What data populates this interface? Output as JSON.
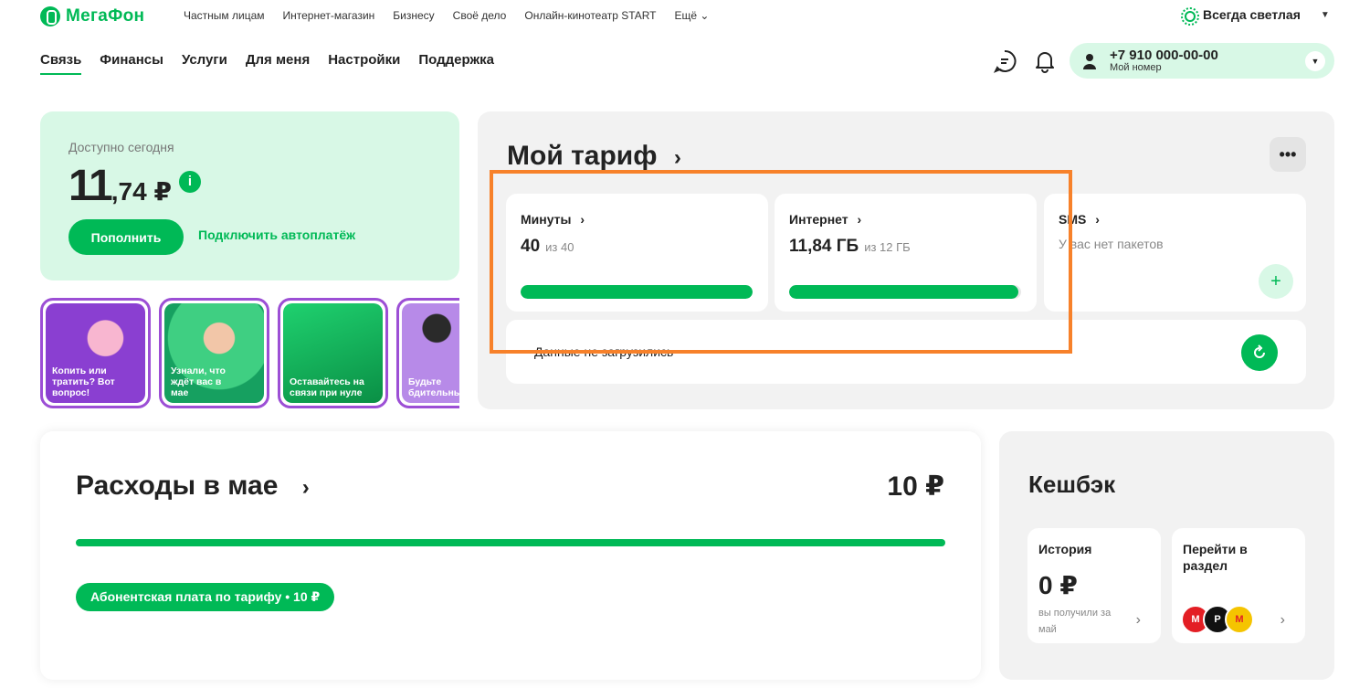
{
  "brand": {
    "name": "МегаФон"
  },
  "top_nav": [
    "Частным лицам",
    "Интернет-магазин",
    "Бизнесу",
    "Своё дело",
    "Онлайн-кинотеатр START",
    "Ещё"
  ],
  "theme": {
    "label": "Всегда светлая"
  },
  "main_nav": [
    "Связь",
    "Финансы",
    "Услуги",
    "Для меня",
    "Настройки",
    "Поддержка"
  ],
  "profile": {
    "phone": "+7 910 000-00-00",
    "caption": "Мой номер"
  },
  "balance": {
    "label": "Доступно сегодня",
    "whole": "11",
    "fraction": ",74 ₽",
    "topup_label": "Пополнить",
    "autopay_label": "Подключить автоплатёж"
  },
  "stories": [
    {
      "caption": "Копить или тратить? Вот вопрос!"
    },
    {
      "caption": "Узнали, что ждёт вас в мае"
    },
    {
      "caption": "Оставайтесь на связи при нуле"
    },
    {
      "caption": "Будьте бдительны"
    }
  ],
  "tariff": {
    "title": "Мой тариф",
    "minutes": {
      "name": "Минуты",
      "value": "40",
      "of": "из 40",
      "fill": 1.0
    },
    "internet": {
      "name": "Интернет",
      "value": "11,84 ГБ",
      "of": "из 12 ГБ",
      "fill": 0.987
    },
    "sms": {
      "name": "SMS",
      "empty": "У вас нет пакетов"
    },
    "error_text": "Данные не загрузились"
  },
  "expenses": {
    "title": "Расходы в мае",
    "total": "10 ₽",
    "chip": "Абонентская плата по тарифу • 10 ₽"
  },
  "cashback": {
    "title": "Кешбэк",
    "history_label": "История",
    "history_value": "0 ₽",
    "history_sub": "вы получили за май",
    "goto_label": "Перейти в раздел"
  },
  "colors": {
    "accent": "#00b956",
    "highlight": "#f7812a",
    "story_border": "#9c4fd5"
  }
}
